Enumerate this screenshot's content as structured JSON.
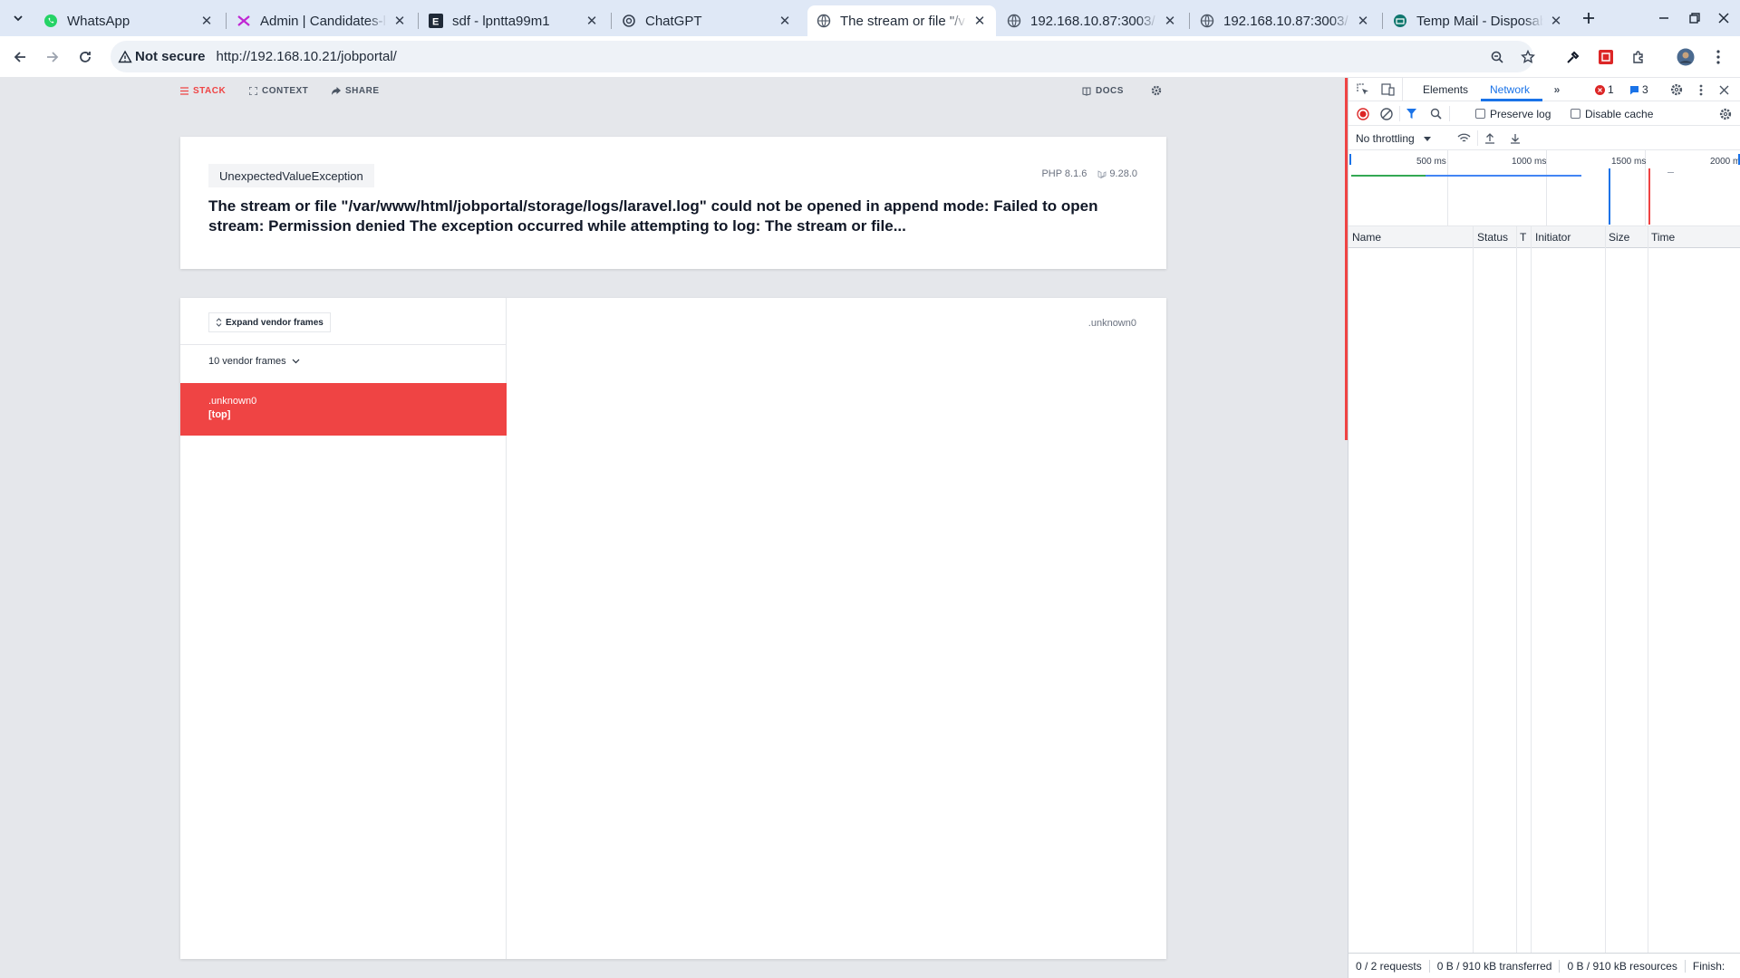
{
  "browser": {
    "tabs": [
      {
        "title": "WhatsApp",
        "icon": "whatsapp-icon",
        "active": false
      },
      {
        "title": "Admin | Candidates-l",
        "icon": "admin-logo-icon",
        "active": false
      },
      {
        "title": "sdf - lpntta99m1",
        "icon": "e-logo-icon",
        "active": false
      },
      {
        "title": "ChatGPT",
        "icon": "chatgpt-icon",
        "active": false
      },
      {
        "title": "The stream or file \"/v",
        "icon": "globe-icon",
        "active": true
      },
      {
        "title": "192.168.10.87:3003/",
        "icon": "globe-icon",
        "active": false
      },
      {
        "title": "192.168.10.87:3003/",
        "icon": "globe-icon",
        "active": false
      },
      {
        "title": "Temp Mail - Disposab",
        "icon": "tempmail-icon",
        "active": false
      }
    ],
    "security_label": "Not secure",
    "url": "http://192.168.10.21/jobportal/"
  },
  "ignition": {
    "nav": {
      "stack": "STACK",
      "context": "CONTEXT",
      "share": "SHARE",
      "docs": "DOCS"
    },
    "exception_class": "UnexpectedValueException",
    "php_version": "PHP 8.1.6",
    "laravel_version": "9.28.0",
    "message": "The stream or file \"/var/www/html/jobportal/storage/logs/laravel.log\" could not be opened in append mode: Failed to open stream: Permission denied The exception occurred while attempting to log: The stream or file...",
    "expand_vendor_label": "Expand vendor frames",
    "vendor_frames_label": "10 vendor frames",
    "active_frame": {
      "file": ".unknown0",
      "method": "[top]"
    },
    "frame_file_header": ".unknown0"
  },
  "devtools": {
    "tabs": {
      "elements": "Elements",
      "network": "Network"
    },
    "error_count": "1",
    "message_count": "3",
    "preserve_log": "Preserve log",
    "disable_cache": "Disable cache",
    "throttling": "No throttling",
    "timeline_labels": [
      "500 ms",
      "1000 ms",
      "1500 ms",
      "2000 m"
    ],
    "columns": [
      "Name",
      "Status",
      "T",
      "Initiator",
      "Size",
      "Time"
    ],
    "status": {
      "requests": "0 / 2 requests",
      "transferred": "0 B / 910 kB transferred",
      "resources": "0 B / 910 kB resources",
      "finish": "Finish:"
    }
  },
  "colors": {
    "accent_red": "#ef4444",
    "devtools_blue": "#1a73e8"
  }
}
